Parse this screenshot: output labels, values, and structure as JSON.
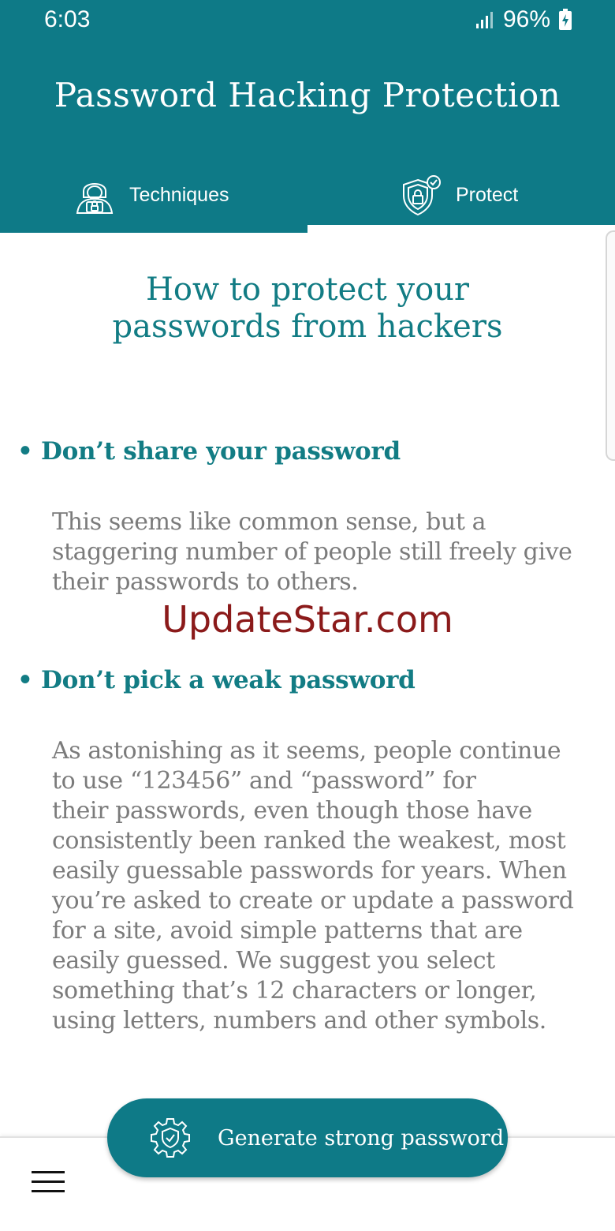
{
  "status": {
    "time": "6:03",
    "battery": "96%",
    "icons": [
      "signal-icon",
      "battery-charging-icon"
    ]
  },
  "app": {
    "title": "Password Hacking Protection"
  },
  "tabs": [
    {
      "label": "Techniques",
      "icon": "hacker-icon",
      "selected": false
    },
    {
      "label": "Protect",
      "icon": "shield-lock-icon",
      "selected": true
    }
  ],
  "content": {
    "title_line1": "How to protect your",
    "title_line2": "passwords from hackers",
    "sections": [
      {
        "heading": "• Don’t share your password",
        "lines": [
          "This seems like common sense, but a",
          "staggering number of people still freely give",
          "their passwords to others."
        ]
      },
      {
        "heading": "• Don’t pick a weak password",
        "lines": [
          "As astonishing as it seems, people continue",
          "to use “123456” and “password” for",
          "their passwords, even though those have",
          "consistently been ranked the weakest, most",
          "easily guessable passwords for years. When",
          "you’re asked to create or update a password",
          "for a site, avoid simple patterns that are",
          "easily guessed. We suggest you select",
          "something that’s 12 characters or longer,",
          "using letters, numbers and other symbols."
        ]
      }
    ]
  },
  "watermark": "UpdateStar.com",
  "fab": {
    "label": "Generate strong password",
    "icon": "gear-shield-icon"
  },
  "bottom_nav": {
    "menu_icon": "hamburger-menu-icon"
  },
  "colors": {
    "primary": "#0e7a87",
    "heading": "#127c84",
    "body_text": "#7b7b7b",
    "watermark": "#8b1a1a"
  }
}
